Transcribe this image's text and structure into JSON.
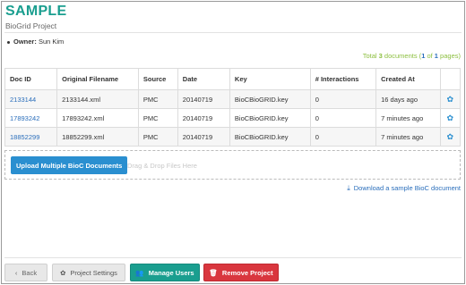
{
  "header": {
    "title": "SAMPLE",
    "subtitle": "BioGrid Project"
  },
  "owner": {
    "label": "Owner:",
    "name": "Sun Kim"
  },
  "summary": {
    "prefix": "Total ",
    "count": "3",
    "suffix": " documents (",
    "page_current": "1",
    "page_of": " of ",
    "page_total": "1",
    "page_suffix": " pages)"
  },
  "table": {
    "columns": [
      "Doc ID",
      "Original Filename",
      "Source",
      "Date",
      "Key",
      "# Interactions",
      "Created At",
      ""
    ],
    "rows": [
      {
        "doc_id": "2133144",
        "filename": "2133144.xml",
        "source": "PMC",
        "date": "20140719",
        "key": "BioCBioGRID.key",
        "interactions": "0",
        "created": "16 days ago"
      },
      {
        "doc_id": "17893242",
        "filename": "17893242.xml",
        "source": "PMC",
        "date": "20140719",
        "key": "BioCBioGRID.key",
        "interactions": "0",
        "created": "7 minutes ago"
      },
      {
        "doc_id": "18852299",
        "filename": "18852299.xml",
        "source": "PMC",
        "date": "20140719",
        "key": "BioCBioGRID.key",
        "interactions": "0",
        "created": "7 minutes ago"
      }
    ],
    "row_icon": "gear-icon"
  },
  "upload": {
    "button_label": "Upload Multiple BioC Documents",
    "drop_text": "Drag & Drop Files Here"
  },
  "sample_link": {
    "icon": "download-icon",
    "label": "Download a sample BioC document"
  },
  "footer": {
    "back_label": "Back",
    "back_icon": "chevron-left-icon",
    "settings_label": "Project Settings",
    "settings_icon": "gear-icon",
    "users_label": "Manage Users",
    "users_icon": "users-icon",
    "remove_label": "Remove Project",
    "remove_icon": "trash-icon"
  },
  "colors": {
    "brand": "#1a9e8f",
    "link": "#2a6ebb",
    "primary": "#2a8fd0",
    "danger": "#d9363e",
    "summary": "#8cbf3f"
  }
}
